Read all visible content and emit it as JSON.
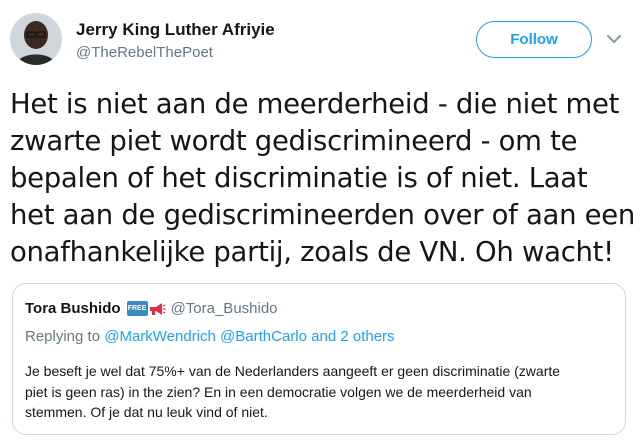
{
  "author": {
    "name": "Jerry King Luther Afriyie",
    "handle": "@TheRebelThePoet",
    "avatar_icon": "profile-photo"
  },
  "follow_button": {
    "label": "Follow",
    "color": "#1da1f2"
  },
  "menu_icon": "chevron-down-icon",
  "tweet": {
    "lines": [
      "Het is niet aan de meerderheid - die niet met",
      "zwarte piet wordt gediscrimineerd - om te",
      "bepalen of het discriminatie is of niet. Laat",
      "het aan de gediscrimineerden over of aan een",
      "onafhankelijke partij, zoals de VN. Oh wacht!"
    ]
  },
  "quoted_tweet": {
    "name": "Tora Bushido",
    "badges": [
      "free-badge",
      "megaphone-icon"
    ],
    "free_badge_text": "FREE",
    "handle": "@Tora_Bushido",
    "replying_prefix": "Replying to ",
    "replying_mention_1": "@MarkWendrich",
    "replying_mention_2": "@BarthCarlo",
    "replying_suffix": " and 2 others",
    "body_lines": [
      "Je beseft je wel dat 75%+ van de Nederlanders aangeeft er geen discriminatie (zwarte",
      "piet is geen ras) in the zien? En in een democratie volgen we de meerderheid van",
      "stemmen. Of je dat nu leuk vind of niet."
    ]
  }
}
